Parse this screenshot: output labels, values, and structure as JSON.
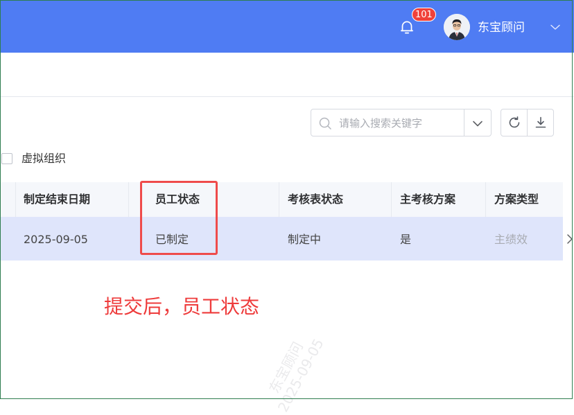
{
  "header": {
    "notification_count": "101",
    "user_name": "东宝顾问",
    "icons": [
      "bell-icon",
      "avatar",
      "chevron-down-icon"
    ],
    "bg_color": "#4f7cf3"
  },
  "toolbar": {
    "search_placeholder": "请输入搜索关键字",
    "icons": [
      "search-icon",
      "chevron-down-icon",
      "refresh-icon",
      "download-icon"
    ]
  },
  "filter": {
    "virtual_org_label": "虚拟组织",
    "virtual_org_checked": false
  },
  "table": {
    "columns": [
      "制定结束日期",
      "员工状态",
      "考核表状态",
      "主考核方案",
      "方案类型"
    ],
    "rows": [
      [
        "2025-09-05",
        "已制定",
        "制定中",
        "是",
        "主绩效"
      ]
    ]
  },
  "annotation": {
    "text": "提交后，员工状态",
    "color": "#ee3b3b"
  },
  "watermark": {
    "line1": "东宝顾问",
    "line2": "2025-09-05"
  }
}
